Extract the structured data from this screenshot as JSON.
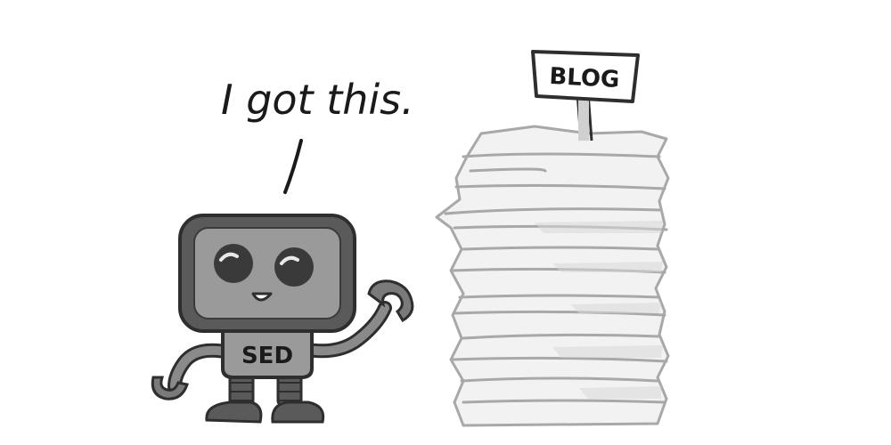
{
  "speech": {
    "text": "I got this."
  },
  "robot": {
    "label": "SED"
  },
  "sign": {
    "label": "BLOG"
  },
  "colors": {
    "outline": "#3a3a3a",
    "robot_body": "#5a5a5a",
    "robot_screen": "#9a9a9a",
    "paper": "#f2f2f2",
    "paper_edge": "#a8a8a8",
    "sign_board": "#ffffff"
  }
}
